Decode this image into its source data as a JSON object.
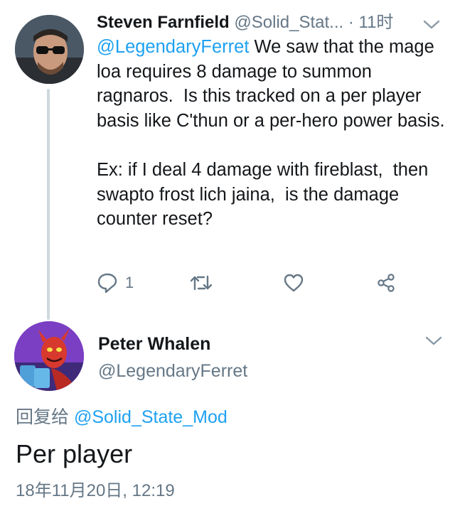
{
  "parent_tweet": {
    "author_name": "Steven Farnfield",
    "author_handle": "@Solid_Stat...",
    "time": "· 11时",
    "mention": "@LegendaryFerret",
    "text_after_mention": " We saw that the mage loa requires 8 damage to summon ragnaros.  Is this tracked on a per player basis like C'thun or a per-hero power basis.\n\nEx: if I deal 4 damage with fireblast,  then swapto frost lich jaina,  is the damage counter reset?",
    "reply_count": "1",
    "icons": {
      "reply": "reply-icon",
      "retweet": "retweet-icon",
      "like": "heart-icon",
      "share": "share-icon",
      "menu": "chevron-down-icon"
    }
  },
  "reply_tweet": {
    "author_name": "Peter Whalen",
    "author_handle": "@LegendaryFerret",
    "reply_to_label": "回复给",
    "reply_to_handle": "@Solid_State_Mod",
    "text": "Per player",
    "timestamp": "18年11月20日, 12:19"
  },
  "colors": {
    "accent": "#1da1f2",
    "secondary_text": "#657786",
    "primary_text": "#14171a",
    "thread_line": "#cfd9de"
  }
}
